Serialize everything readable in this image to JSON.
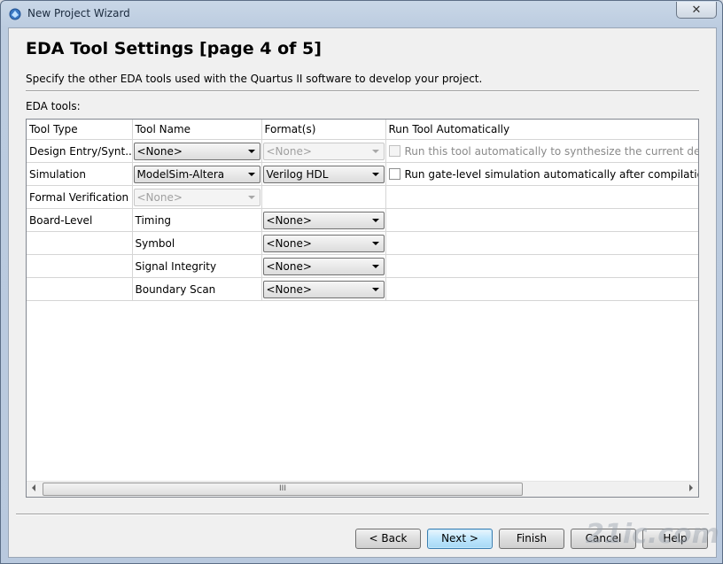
{
  "window": {
    "title": "New Project Wizard",
    "close_label": "✕"
  },
  "page": {
    "heading": "EDA Tool Settings [page 4 of 5]",
    "description": "Specify the other EDA tools used with the Quartus II software to develop your project.",
    "eda_label": "EDA tools:"
  },
  "table": {
    "headers": [
      "Tool Type",
      "Tool Name",
      "Format(s)",
      "Run Tool Automatically"
    ],
    "rows": [
      {
        "type": "Design Entry/Synt...",
        "name": "<None>",
        "format": "<None>",
        "run": "Run this tool automatically to synthesize the current design"
      },
      {
        "type": "Simulation",
        "name": "ModelSim-Altera",
        "format": "Verilog HDL",
        "run": "Run gate-level simulation automatically after compilation"
      },
      {
        "type": "Formal Verification",
        "name": "<None>"
      },
      {
        "type": "Board-Level",
        "name": "Timing",
        "format": "<None>"
      },
      {
        "name": "Symbol",
        "format": "<None>"
      },
      {
        "name": "Signal Integrity",
        "format": "<None>"
      },
      {
        "name": "Boundary Scan",
        "format": "<None>"
      }
    ],
    "scroll_grip": "III"
  },
  "buttons": {
    "back": "< Back",
    "next": "Next >",
    "finish": "Finish",
    "cancel": "Cancel",
    "help": "Help"
  },
  "watermark": "21ic.com",
  "colors": {
    "default_button": "#a7d9f5",
    "titlebar": "#c9d7e7"
  }
}
